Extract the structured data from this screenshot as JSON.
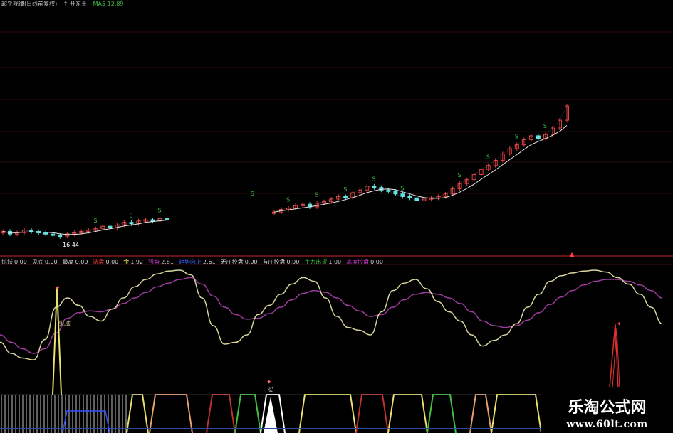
{
  "colors": {
    "bg": "#000000",
    "separator": "#8a1b1b",
    "kdj_k": "#d8d49a",
    "kdj_d": "#9c3c9c",
    "alert": "#ff4040"
  },
  "top_header": {
    "title": "超乎规律(日线前复权)",
    "sub": "↑ 开东王",
    "value": "MA5 12.89"
  },
  "price_panel": {
    "min_label": "16.44",
    "marker": "S"
  },
  "indicator_header": {
    "items": [
      {
        "name": "抓妖",
        "val": "0.00",
        "color": "#cfcfcf"
      },
      {
        "name": "见底",
        "val": "0.00",
        "color": "#cfcfcf"
      },
      {
        "name": "最高",
        "val": "0.00",
        "color": "#e0e0e0"
      },
      {
        "name": "洗盘",
        "val": "0.00",
        "color": "#ff3b3b"
      },
      {
        "name": "金",
        "val": "1.92",
        "color": "#ffff66"
      },
      {
        "name": "强势",
        "val": "2.81",
        "color": "#d040d0"
      },
      {
        "name": "趋势向上",
        "val": "2.61",
        "color": "#4060ff"
      },
      {
        "name": "无庄控盘",
        "val": "0.00",
        "color": "#e0e0e0"
      },
      {
        "name": "有庄控盘",
        "val": "0.00",
        "color": "#e0e0e0"
      },
      {
        "name": "主力出货",
        "val": "1.00",
        "color": "#40c040"
      },
      {
        "name": "高度控盘",
        "val": "0.00",
        "color": "#d040d0"
      }
    ]
  },
  "labels": {
    "bottom_label": "见底",
    "signal_label": "买"
  },
  "watermark": {
    "line1": "乐淘公式网",
    "line2": "www.60lt.com"
  },
  "chart_data": [
    {
      "type": "candlestick",
      "title": "超乎规律(日线前复权)",
      "x": [
        1,
        2,
        3,
        4,
        5,
        6,
        7,
        8,
        9,
        10,
        11,
        12,
        13,
        14,
        15,
        16,
        17,
        18,
        19,
        20,
        21,
        22,
        23,
        24,
        25,
        26,
        27,
        28,
        29,
        30,
        31,
        32,
        33,
        34,
        35,
        36,
        37,
        38,
        39,
        40,
        41,
        42,
        43,
        44,
        45,
        46,
        47,
        48,
        49,
        50,
        51,
        52,
        53,
        54,
        55,
        56,
        57,
        58,
        59,
        60,
        61,
        62,
        63,
        64,
        65,
        66,
        67,
        68,
        69,
        70,
        71,
        72,
        73,
        74,
        75,
        76,
        77,
        78,
        79,
        80
      ],
      "close": [
        16.8,
        16.6,
        16.7,
        16.9,
        16.8,
        16.7,
        16.6,
        16.5,
        16.44,
        16.6,
        16.7,
        16.8,
        16.9,
        17.0,
        17.2,
        17.1,
        17.3,
        17.5,
        17.4,
        17.6,
        17.7,
        17.6,
        17.8,
        17.7,
        null,
        null,
        null,
        null,
        null,
        null,
        null,
        null,
        null,
        null,
        null,
        null,
        null,
        null,
        18.3,
        18.5,
        18.6,
        18.8,
        18.9,
        18.7,
        19.0,
        19.1,
        19.3,
        19.5,
        19.4,
        19.8,
        20.0,
        20.3,
        20.2,
        20.0,
        19.9,
        19.7,
        19.5,
        19.4,
        19.2,
        19.3,
        19.4,
        19.5,
        19.7,
        20.1,
        20.5,
        20.8,
        21.2,
        21.6,
        21.9,
        22.3,
        22.8,
        23.2,
        23.5,
        23.9,
        24.2,
        24.0,
        24.3,
        24.8,
        25.4,
        26.5
      ],
      "min_label": 16.44
    },
    {
      "type": "line",
      "series": [
        {
          "values": [
            22,
            10,
            5,
            3,
            25,
            60,
            70,
            62,
            50,
            45,
            58,
            70,
            82,
            90,
            96,
            99,
            100,
            95,
            70,
            40,
            20,
            22,
            30,
            52,
            62,
            74,
            85,
            92,
            88,
            70,
            50,
            38,
            35,
            30,
            55,
            78,
            86,
            90,
            80,
            66,
            55,
            45,
            30,
            18,
            24,
            30,
            42,
            60,
            74,
            88,
            94,
            97,
            99,
            100,
            98,
            92,
            85,
            74,
            60,
            42
          ]
        },
        {
          "values": [
            30,
            22,
            15,
            10,
            15,
            32,
            48,
            54,
            56,
            55,
            58,
            64,
            70,
            76,
            82,
            86,
            90,
            92,
            85,
            72,
            60,
            52,
            47,
            48,
            53,
            60,
            68,
            75,
            78,
            76,
            70,
            62,
            56,
            50,
            52,
            60,
            68,
            74,
            76,
            74,
            70,
            64,
            55,
            45,
            40,
            38,
            40,
            46,
            54,
            63,
            71,
            78,
            84,
            88,
            90,
            90,
            88,
            84,
            78,
            70
          ]
        }
      ],
      "signals": {
        "see_bottom_at": 5,
        "buy_at": "middle",
        "sell_at": "right"
      }
    }
  ]
}
